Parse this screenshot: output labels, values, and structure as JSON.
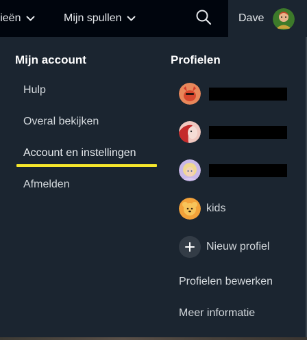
{
  "topbar": {
    "categories_label": "orieën",
    "my_stuff_label": "Mijn spullen",
    "search_icon": "search-icon",
    "profile_name": "Dave"
  },
  "dropdown": {
    "account": {
      "title": "Mijn account",
      "links": [
        "Hulp",
        "Overal bekijken",
        "Account en instellingen",
        "Afmelden"
      ],
      "highlighted": "Account en instellingen",
      "highlight_color": "#f5e62c"
    },
    "profiles": {
      "title": "Profielen",
      "kids_label": "kids",
      "new_profile_label": "Nieuw profiel",
      "edit_label": "Profielen bewerken",
      "info_label": "Meer informatie"
    }
  },
  "colors": {
    "topbar_bg": "#00050d",
    "panel_bg": "#1b2530",
    "text_primary": "#ffffff",
    "text_secondary": "#d4d9dd"
  }
}
